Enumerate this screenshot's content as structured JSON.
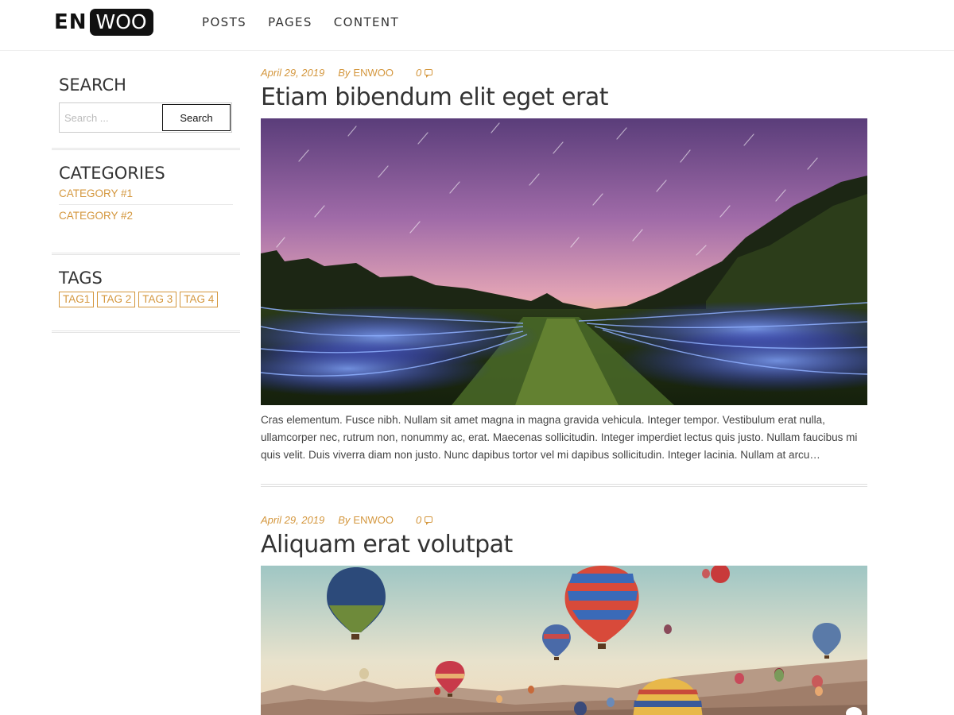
{
  "header": {
    "logo_left": "EN",
    "logo_right": "WOO",
    "nav": [
      {
        "label": "POSTS"
      },
      {
        "label": "PAGES"
      },
      {
        "label": "CONTENT"
      }
    ]
  },
  "sidebar": {
    "search": {
      "title": "SEARCH",
      "placeholder": "Search ...",
      "button_label": "Search"
    },
    "categories": {
      "title": "CATEGORIES",
      "items": [
        {
          "label": "CATEGORY #1"
        },
        {
          "label": "CATEGORY #2"
        }
      ]
    },
    "tags": {
      "title": "TAGS",
      "items": [
        {
          "label": "TAG1"
        },
        {
          "label": "TAG 2"
        },
        {
          "label": "TAG 3"
        },
        {
          "label": "TAG 4"
        }
      ]
    }
  },
  "posts": [
    {
      "date": "April 29, 2019",
      "by": "By",
      "author": "ENWOO",
      "comments": "0",
      "title": "Etiam bibendum elit eget erat",
      "image": "starry-field-landscape",
      "excerpt": "Cras elementum. Fusce nibh. Nullam sit amet magna in magna gravida vehicula. Integer tempor. Vestibulum erat nulla, ullamcorper nec, rutrum non, nonummy ac, erat. Maecenas sollicitudin. Integer imperdiet lectus quis justo. Nullam faucibus mi quis velit. Duis viverra diam non justo. Nunc dapibus tortor vel mi dapibus sollicitudin. Integer lacinia. Nullam at arcu…"
    },
    {
      "date": "April 29, 2019",
      "by": "By",
      "author": "ENWOO",
      "comments": "0",
      "title": "Aliquam erat volutpat",
      "image": "hot-air-balloons"
    }
  ],
  "colors": {
    "accent": "#d4973e",
    "text": "#333333",
    "border": "#e4e4e4"
  }
}
